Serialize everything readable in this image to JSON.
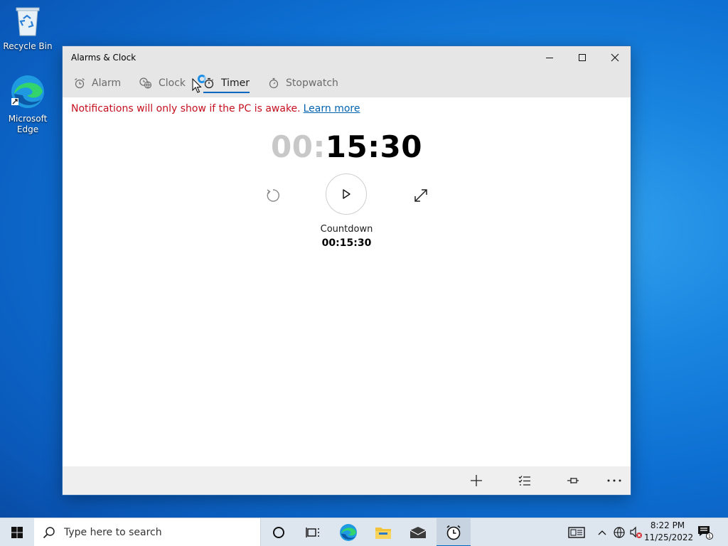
{
  "desktop": {
    "icons": [
      {
        "label": "Recycle Bin",
        "icon": "recycle-bin-icon"
      },
      {
        "label": "Microsoft Edge",
        "icon": "edge-icon"
      }
    ]
  },
  "window": {
    "title": "Alarms & Clock",
    "controls": {
      "minimize": "minimize-icon",
      "maximize": "maximize-icon",
      "close": "close-icon"
    }
  },
  "tabs": [
    {
      "label": "Alarm",
      "icon": "alarm-icon",
      "active": false
    },
    {
      "label": "Clock",
      "icon": "world-clock-icon",
      "active": false
    },
    {
      "label": "Timer",
      "icon": "timer-icon",
      "active": true
    },
    {
      "label": "Stopwatch",
      "icon": "stopwatch-icon",
      "active": false
    }
  ],
  "notice": {
    "text": "Notifications will only show if the PC is awake.",
    "link": "Learn more"
  },
  "timer": {
    "hours": "00",
    "sep1": ":",
    "rest": "15:30",
    "name": "Countdown",
    "duration": "00:15:30"
  },
  "command_bar": {
    "items": [
      "add-icon",
      "edit-list-icon",
      "pin-icon",
      "more-icon"
    ]
  },
  "taskbar": {
    "search_placeholder": "Type here to search",
    "apps": [
      "cortana-icon",
      "task-view-icon",
      "edge-icon",
      "file-explorer-icon",
      "mail-icon",
      "alarms-clock-icon"
    ],
    "time": "8:22 PM",
    "date": "11/25/2022",
    "notification_count": "1"
  },
  "colors": {
    "accent": "#0067c0",
    "notice_red": "#c50f1f",
    "link_blue": "#0063b1"
  }
}
